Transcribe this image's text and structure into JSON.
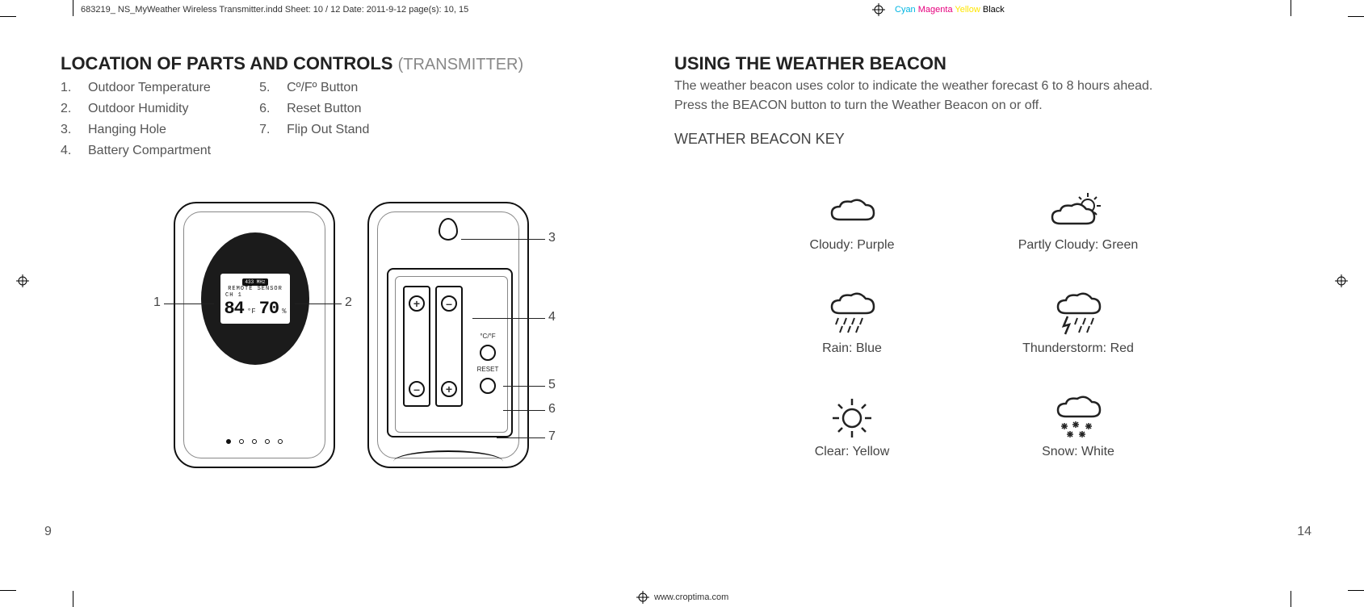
{
  "header": {
    "file_info": "683219_ NS_MyWeather Wireless Transmitter.indd   Sheet: 10 / 12   Date: 2011-9-12   page(s): 10, 15",
    "colors": {
      "cyan": "Cyan",
      "magenta": "Magenta",
      "yellow": "Yellow",
      "black": "Black"
    }
  },
  "footer": {
    "url": "www.croptima.com"
  },
  "left_page": {
    "title_main": "LOCATION OF PARTS AND CONTROLS",
    "title_sub": "(TRANSMITTER)",
    "list_col1": [
      {
        "num": "1.",
        "text": "Outdoor Temperature"
      },
      {
        "num": "2.",
        "text": "Outdoor Humidity"
      },
      {
        "num": "3.",
        "text": "Hanging Hole"
      },
      {
        "num": "4.",
        "text": "Battery Compartment"
      }
    ],
    "list_col2": [
      {
        "num": "5.",
        "text": "Cº/Fº Button"
      },
      {
        "num": "6.",
        "text": "Reset Button"
      },
      {
        "num": "7.",
        "text": "Flip Out Stand"
      }
    ],
    "callouts": {
      "c1": "1",
      "c2": "2",
      "c3": "3",
      "c4": "4",
      "c5": "5",
      "c6": "6",
      "c7": "7"
    },
    "lcd": {
      "freq_badge": "433 MHz",
      "sensor_label": "REMOTE SENSOR",
      "ch_label": "CH  1",
      "temp_val": "84",
      "temp_unit": "°F",
      "hum_val": "70",
      "hum_unit": "%"
    },
    "back_labels": {
      "cf": "°C/°F",
      "reset": "RESET"
    },
    "page_num": "9"
  },
  "right_page": {
    "title": "USING THE WEATHER BEACON",
    "para1": "The weather beacon uses color to indicate the weather forecast 6 to 8 hours ahead.",
    "para2": "Press the BEACON button to turn the Weather Beacon on or off.",
    "sub": "WEATHER BEACON KEY",
    "beacons": [
      {
        "label": "Cloudy: Purple"
      },
      {
        "label": "Partly Cloudy: Green"
      },
      {
        "label": "Rain: Blue"
      },
      {
        "label": "Thunderstorm: Red"
      },
      {
        "label": "Clear: Yellow"
      },
      {
        "label": "Snow: White"
      }
    ],
    "page_num": "14"
  }
}
